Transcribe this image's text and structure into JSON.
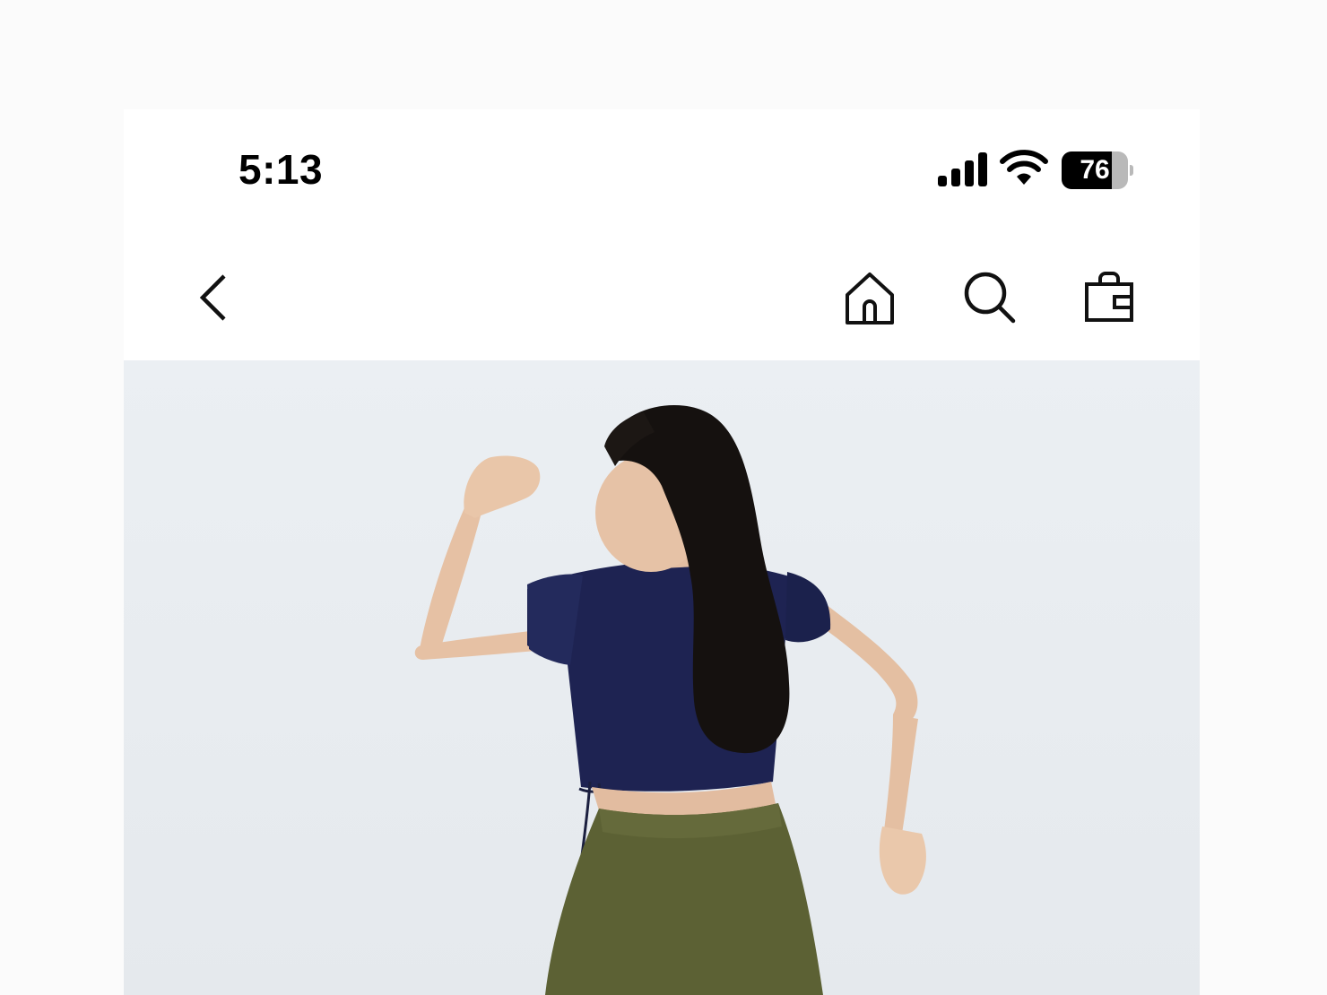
{
  "status_bar": {
    "time": "5:13",
    "battery_level": "76",
    "battery_fraction": 0.76,
    "icons": [
      "signal-icon",
      "wifi-icon",
      "battery-icon"
    ]
  },
  "nav": {
    "icons": [
      "back-chevron-icon",
      "home-icon",
      "search-icon",
      "shopping-bag-icon"
    ]
  },
  "product": {
    "image": "product-photo",
    "colors": {
      "background": "#e8ecf0",
      "top": "#1e2352",
      "pants": "#5c6134",
      "skin": "#e8c4a8",
      "hair": "#15110f"
    }
  }
}
